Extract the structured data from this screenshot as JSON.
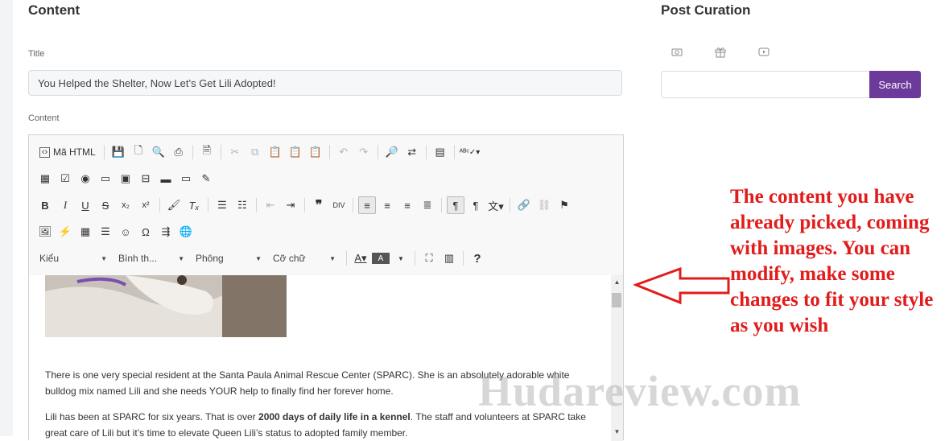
{
  "content_section": {
    "heading": "Content",
    "title_label": "Title",
    "title_value": "You Helped the Shelter, Now Let’s Get Lili Adopted!",
    "content_label": "Content"
  },
  "editor": {
    "toolbar": {
      "source_label": "Mã HTML",
      "format_style": "Kiểu",
      "format_block": "Bình th...",
      "font_family": "Phông",
      "font_size": "Cỡ chữ",
      "help": "?"
    },
    "body": {
      "p1": "There is one very special resident at the Santa Paula Animal Rescue Center (SPARC). She is an absolutely adorable white bulldog mix named Lili and she needs YOUR help to finally find her forever home.",
      "p2_start": "Lili has been at SPARC for six years. That is over ",
      "p2_bold": "2000 days of daily life in a kennel",
      "p2_end": ". The staff and volunteers at SPARC take great care of Lili but it’s time to elevate Queen Lili’s status to adopted family member."
    }
  },
  "post_curation": {
    "heading": "Post Curation",
    "tabs": [
      "image-icon",
      "gift-icon",
      "video-icon"
    ],
    "search_placeholder": "",
    "search_button": "Search",
    "accent_color": "#6b3a9b"
  },
  "annotation": {
    "text": "The content you have already picked, coming with images. You can modify, make some changes to fit your style as you wish",
    "color": "#e21b1b"
  },
  "watermark": "Hudareview.com"
}
